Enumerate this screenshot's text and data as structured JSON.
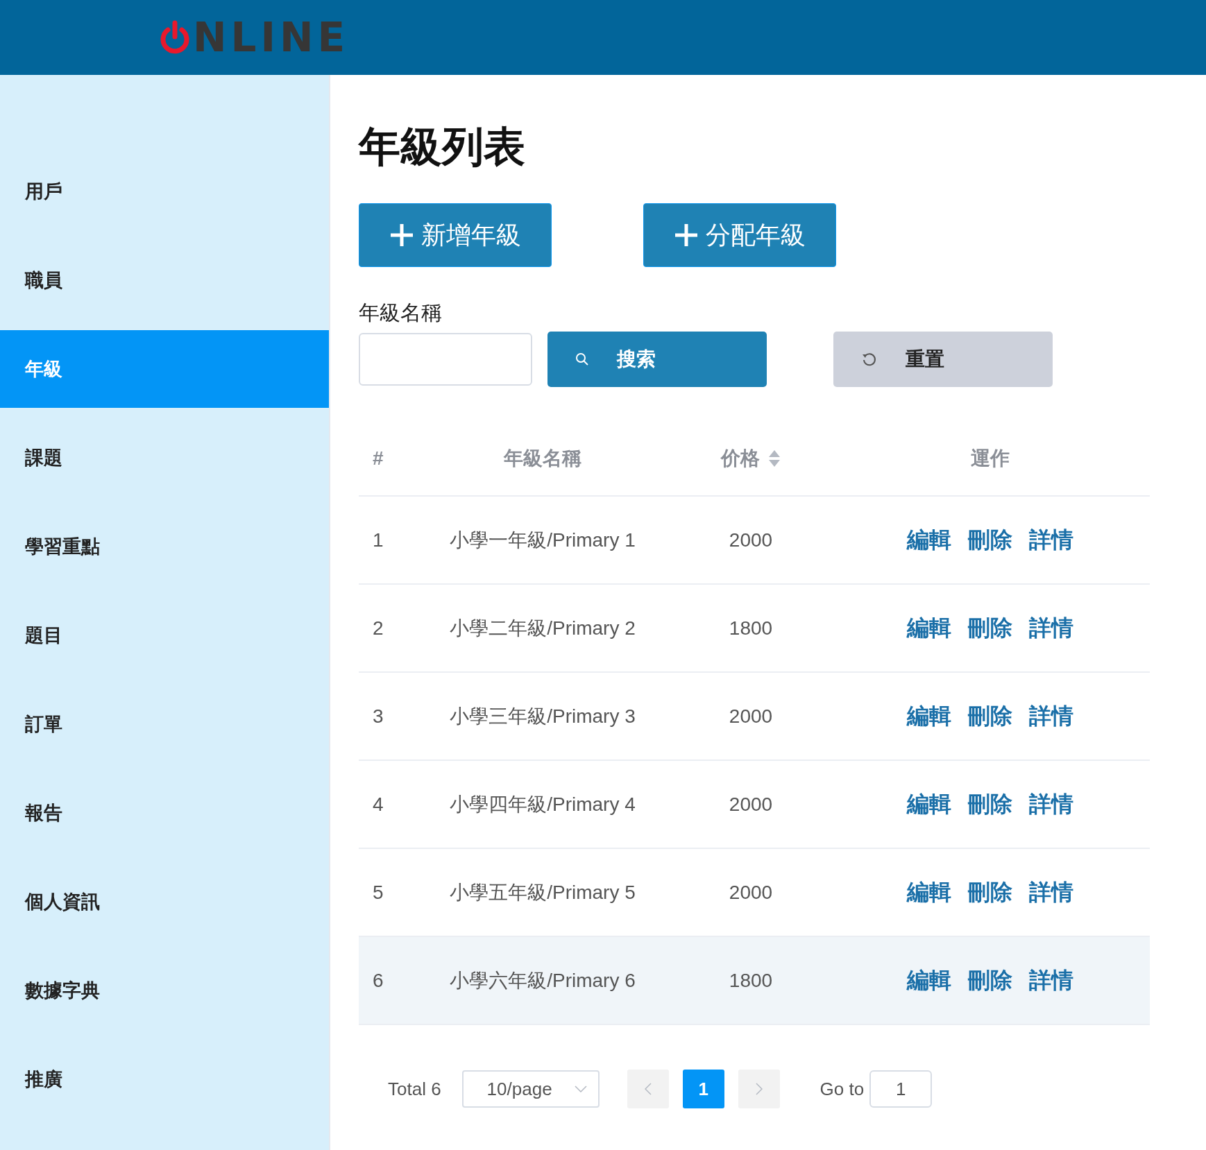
{
  "header": {
    "logo_text": "NLINE"
  },
  "sidebar": {
    "items": [
      {
        "label": "用戶",
        "selected": false
      },
      {
        "label": "職員",
        "selected": false
      },
      {
        "label": "年級",
        "selected": true
      },
      {
        "label": "課題",
        "selected": false
      },
      {
        "label": "學習重點",
        "selected": false
      },
      {
        "label": "題目",
        "selected": false
      },
      {
        "label": "訂單",
        "selected": false
      },
      {
        "label": "報告",
        "selected": false
      },
      {
        "label": "個人資訊",
        "selected": false
      },
      {
        "label": "數據字典",
        "selected": false
      },
      {
        "label": "推廣",
        "selected": false
      }
    ]
  },
  "page_title": "年級列表",
  "action_buttons": [
    "新增年級",
    "分配年級"
  ],
  "filter": {
    "label": "年級名稱",
    "search_button": "搜索",
    "reset_button": "重置"
  },
  "table": {
    "columns": [
      {
        "label": "#",
        "sortable": false
      },
      {
        "label": "年級名稱",
        "sortable": false
      },
      {
        "label": "价格",
        "sortable": true
      },
      {
        "label": "運作",
        "sortable": false
      }
    ],
    "rows": [
      {
        "index": "1",
        "name": "小學一年級/Primary 1",
        "price": "2000",
        "actions": [
          "編輯",
          "刪除",
          "詳情"
        ],
        "hovered": false
      },
      {
        "index": "2",
        "name": "小學二年級/Primary 2",
        "price": "1800",
        "actions": [
          "編輯",
          "刪除",
          "詳情"
        ],
        "hovered": false
      },
      {
        "index": "3",
        "name": "小學三年級/Primary 3",
        "price": "2000",
        "actions": [
          "編輯",
          "刪除",
          "詳情"
        ],
        "hovered": false
      },
      {
        "index": "4",
        "name": "小學四年級/Primary 4",
        "price": "2000",
        "actions": [
          "編輯",
          "刪除",
          "詳情"
        ],
        "hovered": false
      },
      {
        "index": "5",
        "name": "小學五年級/Primary 5",
        "price": "2000",
        "actions": [
          "編輯",
          "刪除",
          "詳情"
        ],
        "hovered": false
      },
      {
        "index": "6",
        "name": "小學六年級/Primary 6",
        "price": "1800",
        "actions": [
          "編輯",
          "刪除",
          "詳情"
        ],
        "hovered": true
      }
    ]
  },
  "pagination": {
    "total": "Total 6",
    "page_size": "10/page",
    "pages": [
      {
        "label": "1",
        "selected": true
      }
    ],
    "goto_label": "Go to",
    "goto_value": "1"
  }
}
